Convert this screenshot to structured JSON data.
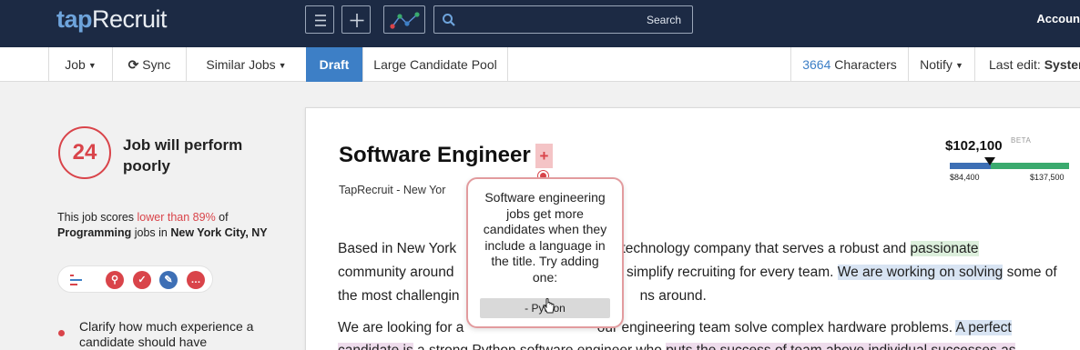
{
  "topbar": {
    "logo_tap": "tap",
    "logo_recruit": "Recruit",
    "search_label": "Search",
    "account_label": "Accoun",
    "icons": [
      "menu-icon",
      "plus-icon",
      "chart-icon",
      "search-icon"
    ]
  },
  "subnav": {
    "job": "Job",
    "sync": "Sync",
    "similar_jobs": "Similar Jobs",
    "draft": "Draft",
    "large_pool": "Large Candidate Pool",
    "char_count": "3664",
    "characters": " Characters",
    "notify": "Notify",
    "last_edit": "Last edit: ",
    "last_edit_value": "Systen"
  },
  "score": {
    "value": "24",
    "verdict": "Job will perform poorly",
    "text_a": "This job scores ",
    "text_red": "lower than 89%",
    "text_b": " of ",
    "category": "Programming",
    "text_c": " jobs in ",
    "location": "New York City, NY",
    "tip": "Clarify how much experience a candidate should have"
  },
  "job": {
    "title": "Software Engineer",
    "plus": "+",
    "company": "TapRecruit   -   New Yor",
    "p1_l1_a": "Based in New York ",
    "p1_l1_b": "owth technology company that serves a robust and ",
    "p1_l1_hl": "passionate",
    "p1_l2_a": "community around ",
    "p1_l2_b": "to simplify recruiting for every team. ",
    "p1_l2_hl": "We are working on solving",
    "p1_l2_c": " some of",
    "p1_l3_a": "the most challengin",
    "p1_l3_b": "ns around.",
    "p2_l1_a": "We are looking for a ",
    "p2_l1_b": "our engineering team solve complex hardware problems. ",
    "p2_l1_hl": "A perfect",
    "p2_l2_hl1": "candidate is",
    "p2_l2_a": " a strong Python software engineer who ",
    "p2_l2_hl2": "puts the success of team above individual successes as"
  },
  "salary": {
    "value": "$102,100",
    "beta": "BETA",
    "min": "$84,400",
    "max": "$137,500",
    "position_fraction": 0.34,
    "colors": {
      "low": "#3d6fb5",
      "high": "#3aaa6e"
    }
  },
  "popup": {
    "text": "Software engineering jobs get more candidates when they include a language in the title. Try adding one:",
    "option": "- Python"
  },
  "colors": {
    "navbar": "#1c2a44",
    "accent": "#3d7fc6",
    "alert": "#d9444a"
  }
}
